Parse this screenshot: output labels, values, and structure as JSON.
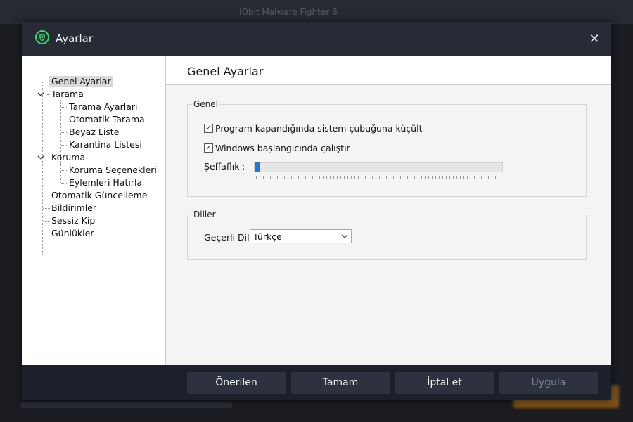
{
  "background": {
    "title": "IObit Malware Fighter 8"
  },
  "dialog": {
    "title": "Ayarlar",
    "close_glyph": "✕",
    "logo_icon": "shield-logo-icon",
    "accent_color": "#3ed06d"
  },
  "tree": {
    "nodes": [
      {
        "label": "Genel Ayarlar",
        "selected": true
      },
      {
        "label": "Tarama",
        "expanded": true
      },
      {
        "label": "Tarama Ayarları"
      },
      {
        "label": "Otomatik Tarama"
      },
      {
        "label": "Beyaz Liste"
      },
      {
        "label": "Karantina Listesi"
      },
      {
        "label": "Koruma",
        "expanded": true
      },
      {
        "label": "Koruma Seçenekleri"
      },
      {
        "label": "Eylemleri Hatırla"
      },
      {
        "label": "Otomatik Güncelleme"
      },
      {
        "label": "Bildirimler"
      },
      {
        "label": "Sessiz Kip"
      },
      {
        "label": "Günlükler"
      }
    ]
  },
  "panel": {
    "title": "Genel Ayarlar",
    "general": {
      "legend": "Genel",
      "minimize_to_tray": {
        "label": "Program kapandığında sistem çubuğuna küçült",
        "checked": true
      },
      "run_on_startup": {
        "label": "Windows başlangıcında çalıştır",
        "checked": true
      },
      "transparency": {
        "label": "Şeffaflık",
        "colon": ":",
        "value": 0
      }
    },
    "languages": {
      "legend": "Diller",
      "current_label": "Geçerli Dil :",
      "selected": "Türkçe"
    }
  },
  "footer": {
    "recommended": "Önerilen",
    "ok": "Tamam",
    "cancel": "İptal et",
    "apply": "Uygula",
    "apply_disabled": true
  },
  "colors": {
    "slider_thumb": "#1e78d6",
    "titlebar": "#262b36",
    "footer": "#1c202a"
  }
}
